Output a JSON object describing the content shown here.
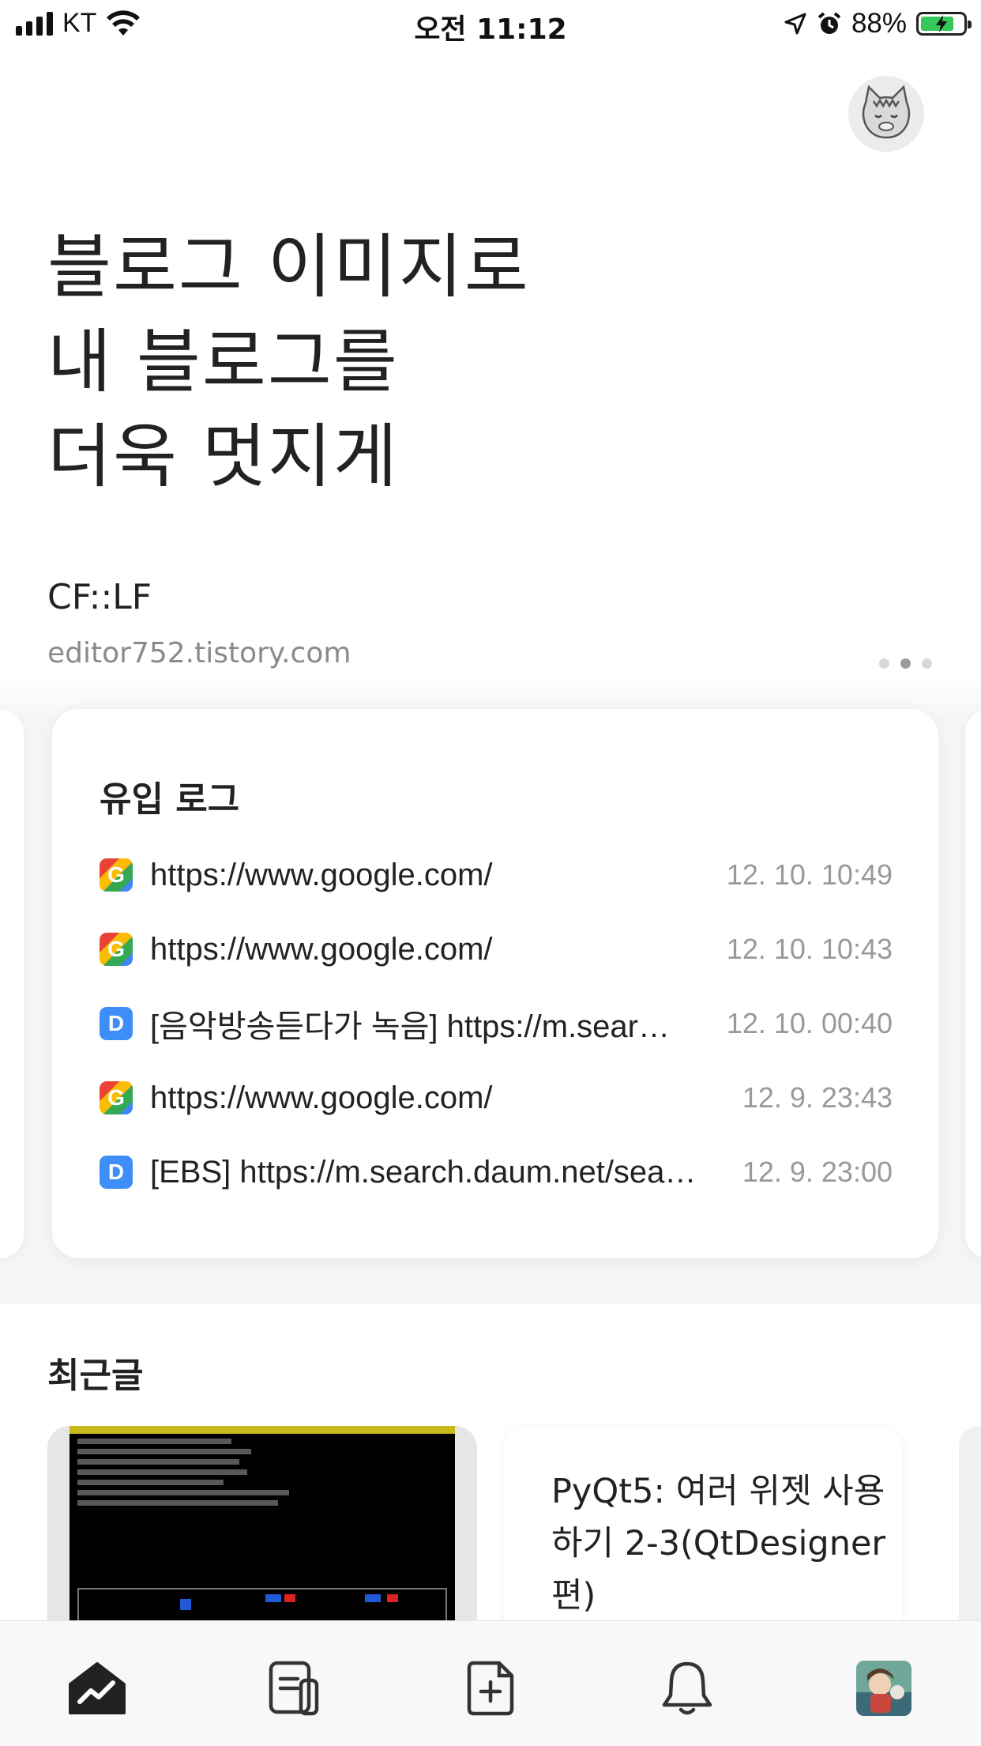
{
  "status_bar": {
    "carrier": "KT",
    "time": "오전 11:12",
    "battery_percent": "88%",
    "battery_level": 0.88,
    "icons": [
      "signal-icon",
      "wifi-icon",
      "location-arrow-icon",
      "alarm-icon",
      "battery-charging-icon"
    ]
  },
  "header": {
    "hero_lines": [
      "블로그 이미지로",
      "내 블로그를",
      "더욱 멋지게"
    ],
    "blog_name": "CF::LF",
    "blog_url": "editor752.tistory.com",
    "page_indicator": {
      "count": 3,
      "active_index": 1
    }
  },
  "inflow_card": {
    "title": "유입 로그",
    "rows": [
      {
        "source": "google",
        "icon_letter": "G",
        "url": "https://www.google.com/",
        "time": "12. 10. 10:49"
      },
      {
        "source": "google",
        "icon_letter": "G",
        "url": "https://www.google.com/",
        "time": "12. 10. 10:43"
      },
      {
        "source": "daum",
        "icon_letter": "D",
        "url": "[음악방송듣다가 녹음] https://m.sear…",
        "time": "12. 10. 00:40"
      },
      {
        "source": "google",
        "icon_letter": "G",
        "url": "https://www.google.com/",
        "time": "12. 9. 23:43"
      },
      {
        "source": "daum",
        "icon_letter": "D",
        "url": "[EBS] https://m.search.daum.net/sea…",
        "time": "12. 9. 23:00"
      }
    ]
  },
  "recent_posts": {
    "title": "최근글",
    "post_title": "PyQt5: 여러 위젯 사용하기 2-3(QtDesigner 편)"
  },
  "tab_bar": {
    "tabs": [
      "home-stats-icon",
      "posts-icon",
      "new-post-icon",
      "notifications-icon",
      "profile-avatar"
    ]
  },
  "colors": {
    "daum_blue": "#3e8ef7",
    "battery_green": "#35c759",
    "muted_text": "#999999"
  }
}
